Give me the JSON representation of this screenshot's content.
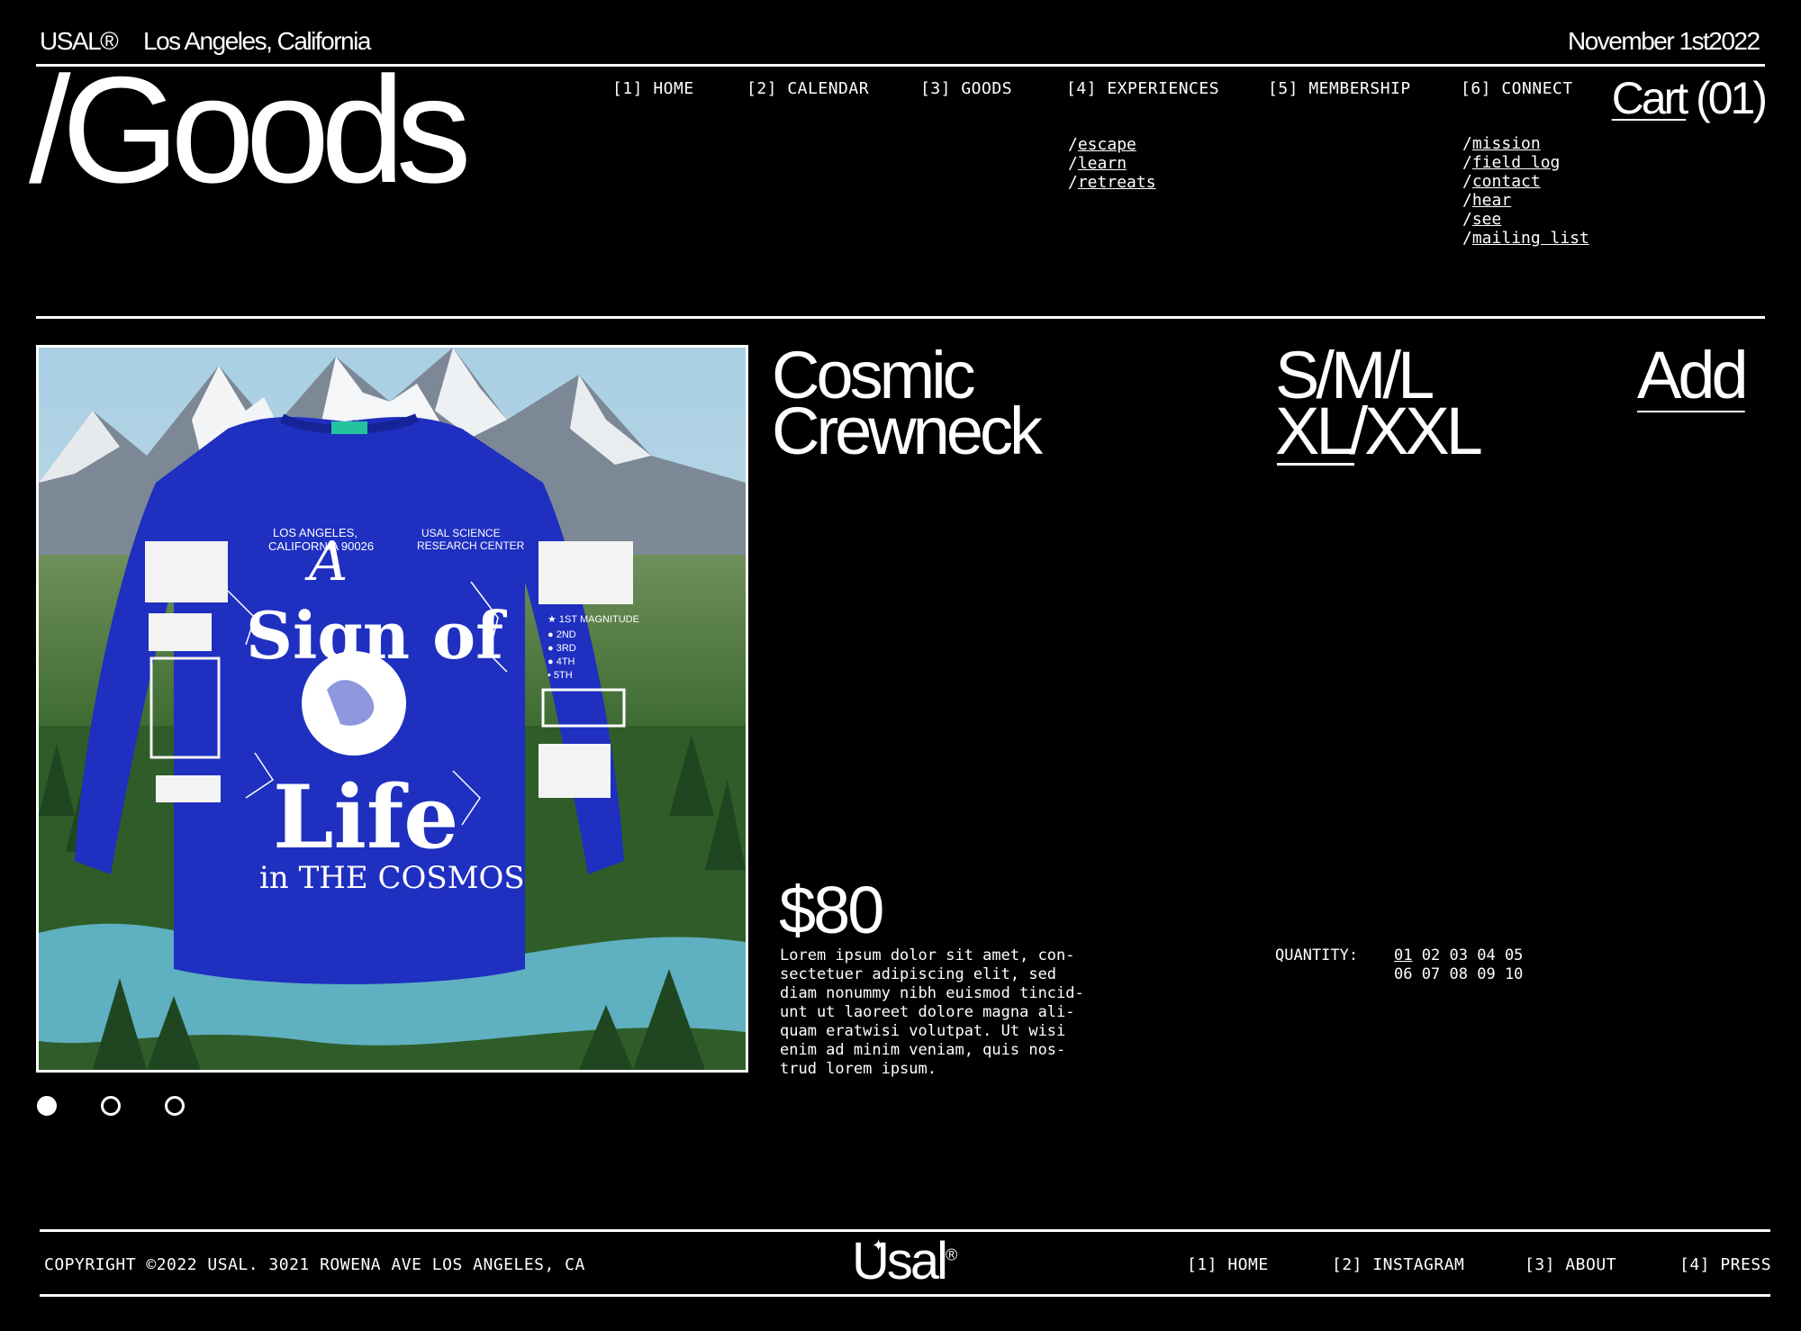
{
  "topbar": {
    "brand": "USAL®",
    "location": "Los Angeles, California",
    "date": "November 1st2022"
  },
  "page_title": "/Goods",
  "nav": {
    "items": [
      {
        "label": "[1] HOME"
      },
      {
        "label": "[2] CALENDAR"
      },
      {
        "label": "[3] GOODS"
      },
      {
        "label": "[4] EXPERIENCES"
      },
      {
        "label": "[5] MEMBERSHIP"
      },
      {
        "label": "[6] CONNECT"
      }
    ],
    "experiences_sub": [
      "escape",
      "learn",
      "retreats"
    ],
    "connect_sub": [
      "mission",
      "field log",
      "contact",
      "hear",
      "see",
      "mailing list"
    ],
    "slash": "/"
  },
  "cart": {
    "label": "Cart",
    "count": "(01)"
  },
  "product": {
    "name_line1": "Cosmic",
    "name_line2": "Crewneck",
    "sizes_line1": "S/M/L",
    "sizes_line2": "XL/XXL",
    "selected_size": "XL",
    "add_label": "Add",
    "price": "$80",
    "description": [
      "Lorem ipsum dolor sit amet, con-",
      "sectetuer adipiscing elit, sed",
      "diam nonummy nibh euismod tincid-",
      "unt ut laoreet dolore magna ali-",
      "quam eratwisi volutpat. Ut wisi",
      "enim ad minim veniam, quis nos-",
      "trud lorem ipsum."
    ],
    "quantity_label": "QUANTITY:",
    "quantities_row1": [
      "01",
      "02",
      "03",
      "04",
      "05"
    ],
    "quantities_row2": [
      "06",
      "07",
      "08",
      "09",
      "10"
    ],
    "selected_quantity": "01",
    "carousel": {
      "total": 3,
      "active": 1
    },
    "shirt_print": {
      "top_left": [
        "LOS ANGELES,",
        "CALIFORNIA 90026"
      ],
      "top_right": [
        "USAL SCIENCE",
        "RESEARCH CENTER"
      ],
      "main": [
        "A",
        "Sign of",
        "Life",
        "in THE COSMOS"
      ],
      "sleeve": [
        "1ST MAGNITUDE",
        "2ND",
        "3RD",
        "4TH",
        "5TH"
      ]
    }
  },
  "footer": {
    "copyright": "COPYRIGHT ©2022 USAL. 3021 ROWENA AVE LOS ANGELES, CA",
    "logo": "Usal",
    "logo_mark": "®",
    "links": [
      "[1] HOME",
      "[2] INSTAGRAM",
      "[3] ABOUT",
      "[4] PRESS"
    ]
  },
  "colors": {
    "background": "#000000",
    "text": "#ffffff",
    "shirt": "#1f2fc0",
    "sky": "#b8d8e8",
    "forest": "#2c5a26",
    "river": "#5fb0c0"
  }
}
